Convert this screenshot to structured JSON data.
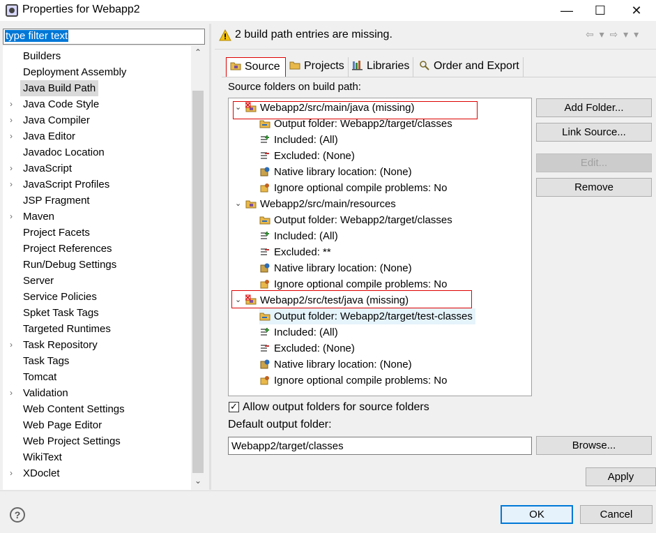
{
  "window": {
    "title": "Properties for Webapp2",
    "controls": {
      "minimize": "—",
      "maximize": "☐",
      "close": "✕"
    }
  },
  "filter": {
    "value": "type filter text"
  },
  "nav": {
    "items": [
      {
        "label": "Builders",
        "expandable": false
      },
      {
        "label": "Deployment Assembly",
        "expandable": false
      },
      {
        "label": "Java Build Path",
        "expandable": false,
        "selected": true
      },
      {
        "label": "Java Code Style",
        "expandable": true
      },
      {
        "label": "Java Compiler",
        "expandable": true
      },
      {
        "label": "Java Editor",
        "expandable": true
      },
      {
        "label": "Javadoc Location",
        "expandable": false
      },
      {
        "label": "JavaScript",
        "expandable": true
      },
      {
        "label": "JavaScript Profiles",
        "expandable": true
      },
      {
        "label": "JSP Fragment",
        "expandable": false
      },
      {
        "label": "Maven",
        "expandable": true
      },
      {
        "label": "Project Facets",
        "expandable": false
      },
      {
        "label": "Project References",
        "expandable": false
      },
      {
        "label": "Run/Debug Settings",
        "expandable": false
      },
      {
        "label": "Server",
        "expandable": false
      },
      {
        "label": "Service Policies",
        "expandable": false
      },
      {
        "label": "Spket Task Tags",
        "expandable": false
      },
      {
        "label": "Targeted Runtimes",
        "expandable": false
      },
      {
        "label": "Task Repository",
        "expandable": true
      },
      {
        "label": "Task Tags",
        "expandable": false
      },
      {
        "label": "Tomcat",
        "expandable": false
      },
      {
        "label": "Validation",
        "expandable": true
      },
      {
        "label": "Web Content Settings",
        "expandable": false
      },
      {
        "label": "Web Page Editor",
        "expandable": false
      },
      {
        "label": "Web Project Settings",
        "expandable": false
      },
      {
        "label": "WikiText",
        "expandable": false
      },
      {
        "label": "XDoclet",
        "expandable": true
      }
    ]
  },
  "header": {
    "message": "2 build path entries are missing.",
    "nav_arrows": "⇦ ▾ ⇨ ▾ ▾"
  },
  "tabs": [
    {
      "label": "Source"
    },
    {
      "label": "Projects"
    },
    {
      "label": "Libraries"
    },
    {
      "label": "Order and Export"
    }
  ],
  "source": {
    "section_label": "Source folders on build path:",
    "folders": [
      {
        "label": "Webapp2/src/main/java (missing)",
        "missing": true,
        "children": [
          "Output folder: Webapp2/target/classes",
          "Included: (All)",
          "Excluded: (None)",
          "Native library location: (None)",
          "Ignore optional compile problems: No"
        ]
      },
      {
        "label": "Webapp2/src/main/resources",
        "missing": false,
        "children": [
          "Output folder: Webapp2/target/classes",
          "Included: (All)",
          "Excluded: **",
          "Native library location: (None)",
          "Ignore optional compile problems: No"
        ]
      },
      {
        "label": "Webapp2/src/test/java (missing)",
        "missing": true,
        "children": [
          "Output folder: Webapp2/target/test-classes",
          "Included: (All)",
          "Excluded: (None)",
          "Native library location: (None)",
          "Ignore optional compile problems: No"
        ]
      }
    ],
    "buttons": {
      "add_folder": "Add Folder...",
      "link_source": "Link Source...",
      "edit": "Edit...",
      "remove": "Remove"
    },
    "allow_output_label": "Allow output folders for source folders",
    "allow_output_checked": true,
    "default_output_label": "Default output folder:",
    "default_output_value": "Webapp2/target/classes",
    "browse_label": "Browse..."
  },
  "footer": {
    "apply": "Apply",
    "ok": "OK",
    "cancel": "Cancel",
    "help": "?"
  },
  "colors": {
    "selection_blue": "#0078d7",
    "missing_red": "#dd0000",
    "row_highlight": "#e5f3fb",
    "warning_yellow": "#f4c20d"
  }
}
